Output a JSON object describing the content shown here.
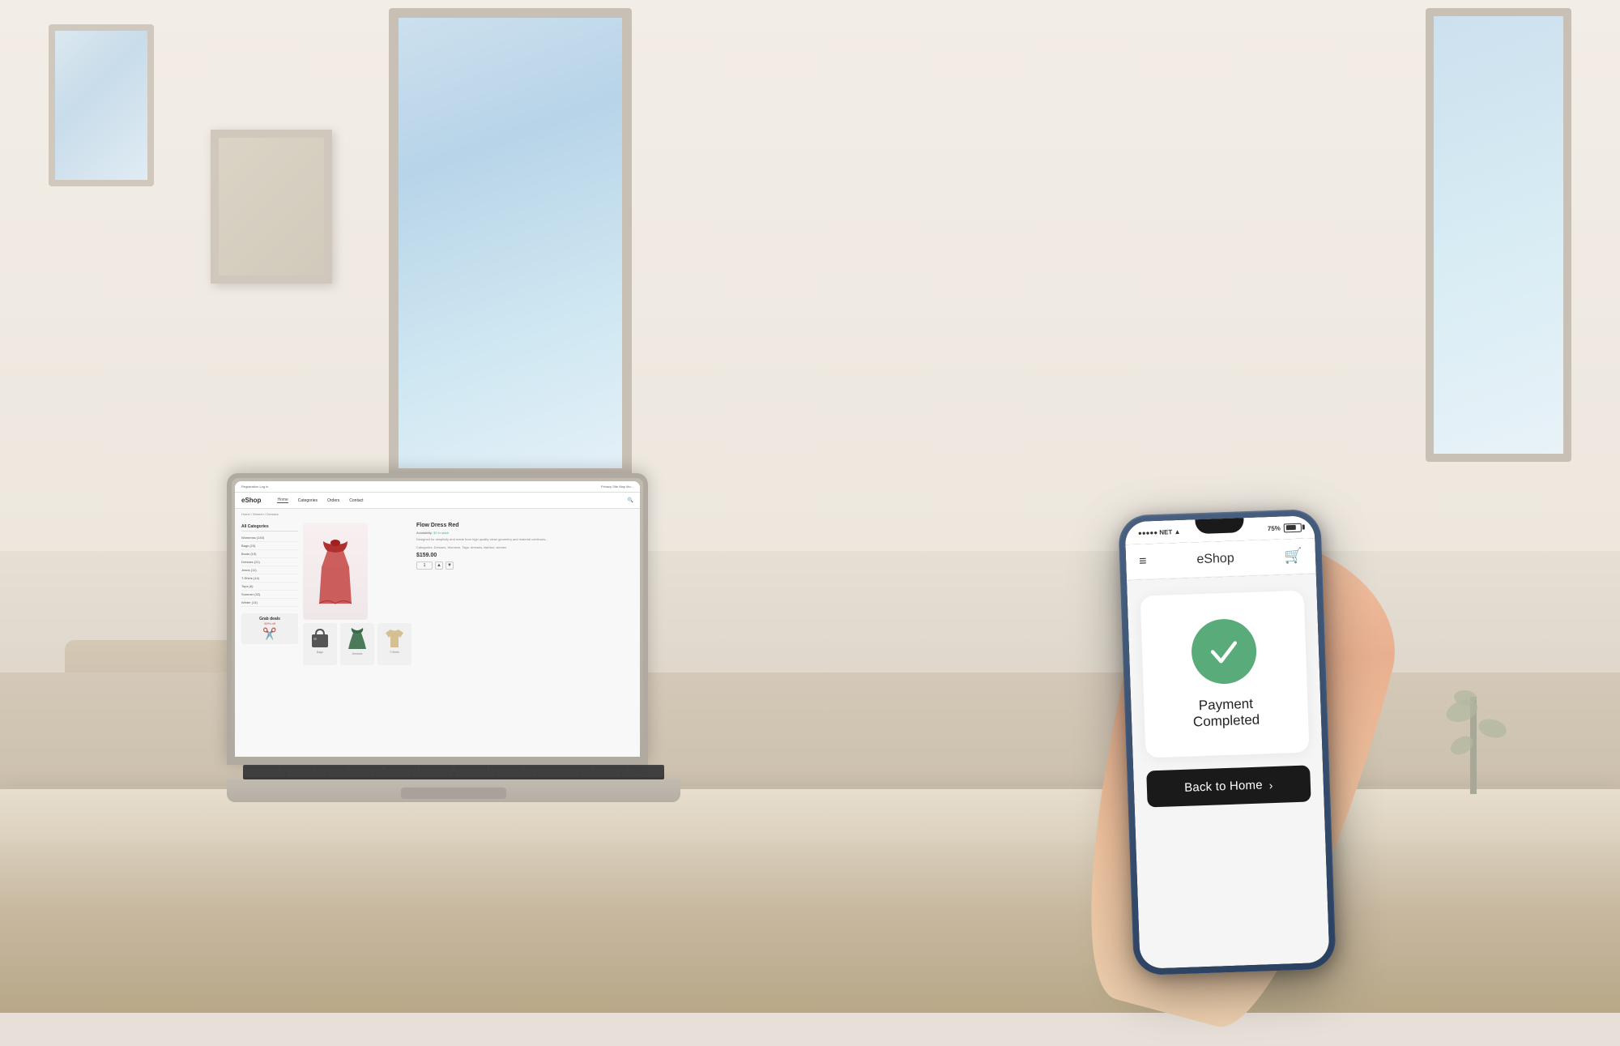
{
  "scene": {
    "background": "room interior with white walls, wooden table",
    "lighting": "bright daylight"
  },
  "laptop": {
    "brand": "eShop",
    "website": {
      "topbar": {
        "left": "Registration  Log in",
        "right": "Privacy  Site Map  Mo..."
      },
      "nav": {
        "logo": "eShop",
        "items": [
          "Home",
          "Categories",
          "Orders",
          "Contact"
        ],
        "search_icon": "🔍"
      },
      "breadcrumb": "Home  /  Women  /  Dresses",
      "sidebar": {
        "title": "All Categories",
        "items": [
          "Womenss (140)",
          "Bags (23)",
          "Boots (19)",
          "Dresses (21)",
          "Jeans (11)",
          "T-Shirts (14)",
          "Tops (6)",
          "Summer (32)",
          "Winter (14)"
        ],
        "promo": {
          "title": "Grab deals",
          "discount": "50% off"
        }
      },
      "product": {
        "title": "Flow Dress Red",
        "availability": "30 in stock",
        "description": "Designed for simplicity and made from high quality clean geometry and material continues...",
        "categories": "Categories: Dresses, Womens, Tags: dresses, fashion, women",
        "price": "$159.00",
        "quantity": "1",
        "thumbnails": [
          {
            "label": "Bags"
          },
          {
            "label": "Dresses"
          },
          {
            "label": "T-Shirts"
          }
        ]
      }
    }
  },
  "phone": {
    "status_bar": {
      "signal": "●●●●● NET",
      "wifi": "▲",
      "battery_percent": "75%",
      "battery_icon": "battery"
    },
    "app_header": {
      "menu_icon": "menu",
      "title": "eShop",
      "cart_icon": "cart"
    },
    "screen": {
      "success_card": {
        "icon": "checkmark",
        "title": "Payment Completed"
      },
      "back_button": {
        "label": "Back to Home",
        "chevron": "›"
      }
    }
  }
}
